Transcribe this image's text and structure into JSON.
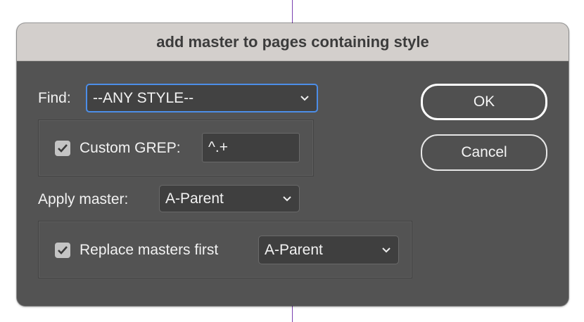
{
  "dialog": {
    "title": "add master to pages containing style"
  },
  "find": {
    "label": "Find:",
    "selected": "--ANY STYLE--",
    "chevron_icon": "chevron-down-icon"
  },
  "custom_grep": {
    "label": "Custom GREP:",
    "checked": true,
    "value": "^.+"
  },
  "apply_master": {
    "label": "Apply master:",
    "selected": "A-Parent"
  },
  "replace_masters": {
    "label": "Replace masters first",
    "checked": true,
    "selected": "A-Parent"
  },
  "buttons": {
    "ok": "OK",
    "cancel": "Cancel"
  },
  "colors": {
    "dialog_bg": "#535353",
    "titlebar_bg": "#d3cfcc",
    "focus_ring": "#4c8ee8",
    "guide_line": "#7a3fb0"
  }
}
